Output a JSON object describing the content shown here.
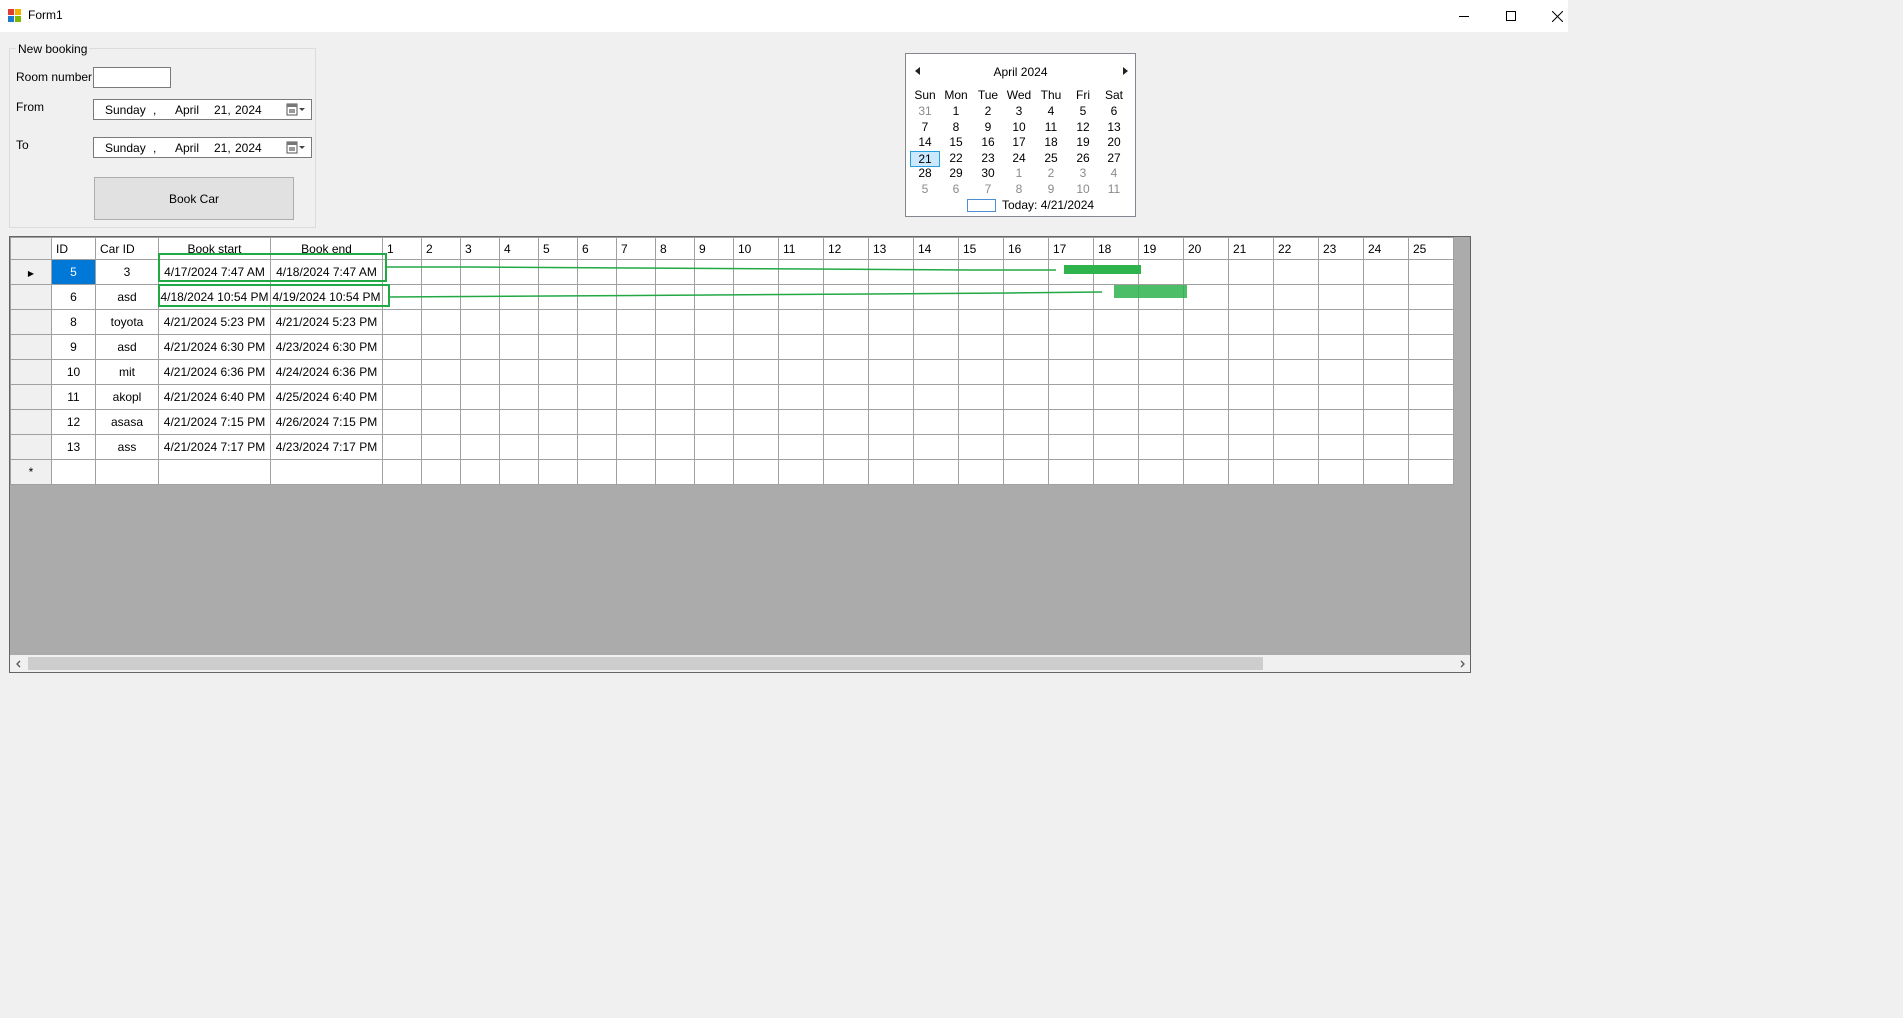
{
  "window": {
    "title": "Form1",
    "controls": {
      "minimize": "minimize-icon",
      "maximize": "maximize-icon",
      "close": "close-icon"
    }
  },
  "booking_form": {
    "group_title": "New booking",
    "room_number_label": "Room number",
    "room_number_value": "",
    "from_label": "From",
    "to_label": "To",
    "from_date": {
      "weekday": "Sunday",
      "sep": ",",
      "month": "April",
      "day": "21,",
      "year": "2024"
    },
    "to_date": {
      "weekday": "Sunday",
      "sep": ",",
      "month": "April",
      "day": "21,",
      "year": "2024"
    },
    "book_button": "Book Car"
  },
  "calendar": {
    "month_title": "April 2024",
    "weekdays": [
      "Sun",
      "Mon",
      "Tue",
      "Wed",
      "Thu",
      "Fri",
      "Sat"
    ],
    "weeks": [
      [
        "31",
        "1",
        "2",
        "3",
        "4",
        "5",
        "6"
      ],
      [
        "7",
        "8",
        "9",
        "10",
        "11",
        "12",
        "13"
      ],
      [
        "14",
        "15",
        "16",
        "17",
        "18",
        "19",
        "20"
      ],
      [
        "21",
        "22",
        "23",
        "24",
        "25",
        "26",
        "27"
      ],
      [
        "28",
        "29",
        "30",
        "1",
        "2",
        "3",
        "4"
      ],
      [
        "5",
        "6",
        "7",
        "8",
        "9",
        "10",
        "11"
      ]
    ],
    "selected_day": "21",
    "today_label": "Today: 4/21/2024"
  },
  "grid": {
    "columns": [
      "ID",
      "Car ID",
      "Book start",
      "Book end"
    ],
    "day_columns": [
      "1",
      "2",
      "3",
      "4",
      "5",
      "6",
      "7",
      "8",
      "9",
      "10",
      "11",
      "12",
      "13",
      "14",
      "15",
      "16",
      "17",
      "18",
      "19",
      "20",
      "21",
      "22",
      "23",
      "24",
      "25"
    ],
    "rows": [
      {
        "id": "5",
        "car_id": "3",
        "book_start": "4/17/2024 7:47 AM",
        "book_end": "4/18/2024 7:47 AM"
      },
      {
        "id": "6",
        "car_id": "asd",
        "book_start": "4/18/2024 10:54 PM",
        "book_end": "4/19/2024 10:54 PM"
      },
      {
        "id": "8",
        "car_id": "toyota",
        "book_start": "4/21/2024 5:23 PM",
        "book_end": "4/21/2024 5:23 PM"
      },
      {
        "id": "9",
        "car_id": "asd",
        "book_start": "4/21/2024 6:30 PM",
        "book_end": "4/23/2024 6:30 PM"
      },
      {
        "id": "10",
        "car_id": "mit",
        "book_start": "4/21/2024 6:36 PM",
        "book_end": "4/24/2024 6:36 PM"
      },
      {
        "id": "11",
        "car_id": "akopl",
        "book_start": "4/21/2024 6:40 PM",
        "book_end": "4/25/2024 6:40 PM"
      },
      {
        "id": "12",
        "car_id": "asasa",
        "book_start": "4/21/2024 7:15 PM",
        "book_end": "4/26/2024 7:15 PM"
      },
      {
        "id": "13",
        "car_id": "ass",
        "book_start": "4/21/2024 7:17 PM",
        "book_end": "4/23/2024 7:17 PM"
      }
    ],
    "current_row_marker": "▶",
    "new_row_marker": "*",
    "highlight_color": "#22a845",
    "booking_bar_color": "#2eb34d",
    "selection_color": "#0078d7"
  }
}
